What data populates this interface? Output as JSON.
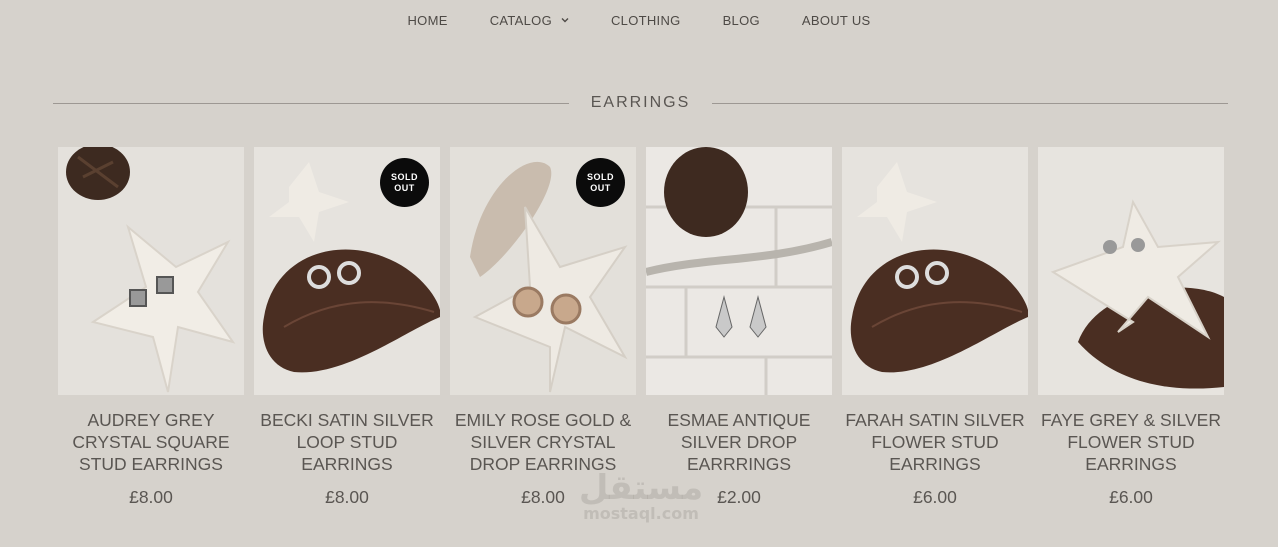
{
  "nav": {
    "items": [
      {
        "label": "HOME"
      },
      {
        "label": "CATALOG",
        "dropdown": true
      },
      {
        "label": "CLOTHING"
      },
      {
        "label": "BLOG"
      },
      {
        "label": "ABOUT US"
      }
    ]
  },
  "section": {
    "title": "EARRINGS"
  },
  "products": [
    {
      "name_lines": [
        "AUDREY GREY",
        "CRYSTAL SQUARE",
        "STUD EARRINGS"
      ],
      "price": "£8.00",
      "sold_out": false,
      "scene": "starfish-pinecone"
    },
    {
      "name_lines": [
        "BECKI SATIN SILVER",
        "LOOP STUD",
        "EARRINGS"
      ],
      "price": "£8.00",
      "sold_out": true,
      "badge_lines": [
        "SOLD",
        "OUT"
      ],
      "scene": "wood-leaf"
    },
    {
      "name_lines": [
        "EMILY ROSE GOLD &",
        "SILVER CRYSTAL",
        "DROP EARRINGS"
      ],
      "price": "£8.00",
      "sold_out": true,
      "badge_lines": [
        "SOLD",
        "OUT"
      ],
      "scene": "starfish-shell"
    },
    {
      "name_lines": [
        "ESMAE ANTIQUE",
        "SILVER DROP",
        "EARRRINGS"
      ],
      "price": "£2.00",
      "sold_out": false,
      "scene": "pinecone-bricks"
    },
    {
      "name_lines": [
        "FARAH SATIN SILVER",
        "FLOWER STUD",
        "EARRINGS"
      ],
      "price": "£6.00",
      "sold_out": false,
      "scene": "wood-leaf"
    },
    {
      "name_lines": [
        "FAYE GREY & SILVER",
        "FLOWER STUD",
        "EARRINGS"
      ],
      "price": "£6.00",
      "sold_out": false,
      "scene": "starfish-wood"
    }
  ],
  "watermark": {
    "arabic": "مستقل",
    "latin": "mostaql.com"
  },
  "colors": {
    "background": "#d6d2cc",
    "text": "#5a5652",
    "badge": "#0b0b0b",
    "wood": "#4a2e22",
    "starfish": "#ece8e1"
  }
}
